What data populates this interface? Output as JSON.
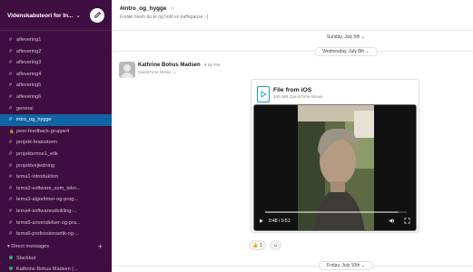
{
  "workspace": {
    "name": "Videnskabsteori for In...",
    "chevron": "⌄"
  },
  "sidebar": {
    "channels": [
      {
        "label": "aflevering1",
        "active": false
      },
      {
        "label": "aflevering2",
        "active": false
      },
      {
        "label": "aflevering3",
        "active": false
      },
      {
        "label": "aflevering4",
        "active": false
      },
      {
        "label": "aflevering5",
        "active": false
      },
      {
        "label": "aflevering6",
        "active": false
      },
      {
        "label": "general",
        "active": false
      },
      {
        "label": "intro_og_hygge",
        "active": true
      },
      {
        "label": "peer-feedback-gruppe4",
        "active": false,
        "private": true
      },
      {
        "label": "projekt-brainstorm",
        "active": false
      },
      {
        "label": "projektemne1_etik",
        "active": false
      },
      {
        "label": "projektvejledning",
        "active": false
      },
      {
        "label": "tema1-introduktion",
        "active": false
      },
      {
        "label": "tema2-software_som_tekn...",
        "active": false
      },
      {
        "label": "tema3-algoritmer-og-prog...",
        "active": false
      },
      {
        "label": "tema4-softwareudvikling-...",
        "active": false
      },
      {
        "label": "tema5-anvendelser-og-pra...",
        "active": false
      },
      {
        "label": "tema6-professionsetik-og-...",
        "active": false
      }
    ],
    "dm_section": {
      "label": "Direct messages",
      "add": "+"
    },
    "dms": [
      {
        "label": "Slackbot"
      },
      {
        "label": "Kathrine Bohus Madsen (..."
      }
    ]
  },
  "header": {
    "channel": "#intro_og_hygge",
    "star": "☆",
    "topic": "Fortæl hvem du er og hold en kaffepause :-)"
  },
  "dates": {
    "top": "Sunday, July 5th",
    "wed": "Wednesday, July 8th",
    "fri": "Friday, July 10th",
    "chevron": "⌄"
  },
  "message": {
    "author": "Kathrine Bohus Madsen",
    "time": "8:55 PM",
    "subtitle": "QuickTime Movie",
    "subtitle_chevron": "⌄",
    "file": {
      "name": "File from iOS",
      "meta": "100 MB QuickTime Movie"
    },
    "video": {
      "time": "0:48 / 0:51",
      "progress": 0.94
    },
    "reactions": [
      {
        "emoji": "👍",
        "count": "1"
      },
      {
        "emoji": "☺",
        "count": ""
      }
    ]
  },
  "colors": {
    "sidebar_bg": "#3f0e40",
    "active_channel": "#1164a3",
    "presence": "#2bac76"
  }
}
